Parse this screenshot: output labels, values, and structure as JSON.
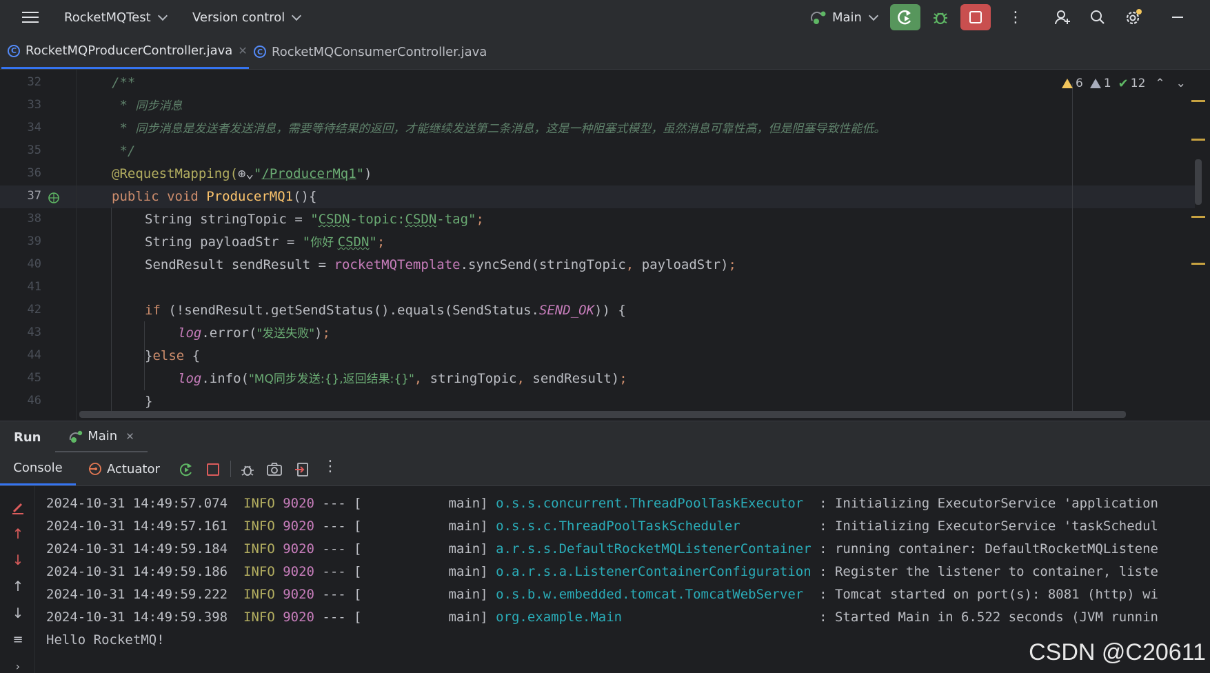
{
  "topbar": {
    "project": "RocketMQTest",
    "vcs": "Version control",
    "run_config": "Main"
  },
  "tabs": [
    {
      "label": "RocketMQProducerController.java",
      "active": true
    },
    {
      "label": "RocketMQConsumerController.java",
      "active": false
    }
  ],
  "inspections": {
    "warnings": "6",
    "weak_warnings": "1",
    "ok": "12"
  },
  "editor": {
    "line_numbers": [
      "32",
      "33",
      "34",
      "35",
      "36",
      "37",
      "38",
      "39",
      "40",
      "41",
      "42",
      "43",
      "44",
      "45",
      "46"
    ],
    "current_line": "37",
    "lines": {
      "l32": "/**",
      "l33_star": " * ",
      "l33_text": "同步消息",
      "l34_star": " * ",
      "l34_text": "同步消息是发送者发送消息，需要等待结果的返回，才能继续发送第二条消息，这是一种阻塞式模型，虽然消息可靠性高，但是阻塞导致性能低。",
      "l35": " */",
      "l36_ann": "@RequestMapping(",
      "l36_globe": "⊕⌄",
      "l36_q1": "\"",
      "l36_path": "/ProducerMq1",
      "l36_q2": "\"",
      "l36_close": ")",
      "l37_kw": "public void ",
      "l37_fn": "ProducerMQ1",
      "l37_rest": "(){",
      "l38_a": "String stringTopic = ",
      "l38_q1": "\"",
      "l38_s1": "CSDN",
      "l38_s2": "-topic:",
      "l38_s3": "CSDN",
      "l38_s4": "-tag",
      "l38_q2": "\"",
      "l38_end": ";",
      "l39_a": "String payloadStr = ",
      "l39_q1": "\"",
      "l39_s1": "你好 ",
      "l39_s2": "CSDN",
      "l39_q2": "\"",
      "l39_end": ";",
      "l40_a": "SendResult sendResult = ",
      "l40_fld": "rocketMQTemplate",
      "l40_b": ".syncSend(stringTopic",
      "l40_c": ", ",
      "l40_d": "payloadStr)",
      "l40_end": ";",
      "l42_kw": "if ",
      "l42_a": "(!sendResult.getSendStatus().equals(SendStatus.",
      "l42_const": "SEND_OK",
      "l42_b": ")) {",
      "l43_log": "log",
      "l43_a": ".error(",
      "l43_str": "\"发送失败\"",
      "l43_b": ")",
      "l43_end": ";",
      "l44_a": "}",
      "l44_kw": "else",
      "l44_b": " {",
      "l45_log": "log",
      "l45_a": ".info(",
      "l45_str": "\"MQ同步发送:{},返回结果:{}\"",
      "l45_c": ", ",
      "l45_b": "stringTopic",
      "l45_d": ", ",
      "l45_e": "sendResult)",
      "l45_end": ";",
      "l46": "}"
    }
  },
  "run_panel": {
    "title": "Run",
    "tab": "Main",
    "console_tab": "Console",
    "actuator_tab": "Actuator"
  },
  "console": {
    "rows": [
      {
        "ts": "2024-10-31 14:49:57.074",
        "level": "INFO",
        "pid": "9020",
        "sep": " --- [           main] ",
        "logger": "o.s.s.concurrent.ThreadPoolTaskExecutor ",
        "msg": " : Initializing ExecutorService 'application"
      },
      {
        "ts": "2024-10-31 14:49:57.161",
        "level": "INFO",
        "pid": "9020",
        "sep": " --- [           main] ",
        "logger": "o.s.s.c.ThreadPoolTaskScheduler         ",
        "msg": " : Initializing ExecutorService 'taskSchedul"
      },
      {
        "ts": "2024-10-31 14:49:59.184",
        "level": "INFO",
        "pid": "9020",
        "sep": " --- [           main] ",
        "logger": "a.r.s.s.DefaultRocketMQListenerContainer",
        "msg": " : running container: DefaultRocketMQListene"
      },
      {
        "ts": "2024-10-31 14:49:59.186",
        "level": "INFO",
        "pid": "9020",
        "sep": " --- [           main] ",
        "logger": "o.a.r.s.a.ListenerContainerConfiguration",
        "msg": " : Register the listener to container, liste"
      },
      {
        "ts": "2024-10-31 14:49:59.222",
        "level": "INFO",
        "pid": "9020",
        "sep": " --- [           main] ",
        "logger": "o.s.b.w.embedded.tomcat.TomcatWebServer ",
        "msg": " : Tomcat started on port(s): 8081 (http) wi"
      },
      {
        "ts": "2024-10-31 14:49:59.398",
        "level": "INFO",
        "pid": "9020",
        "sep": " --- [           main] ",
        "logger": "org.example.Main                        ",
        "msg": " : Started Main in 6.522 seconds (JVM runnin"
      }
    ],
    "hello": "Hello RocketMQ!",
    "watermark": "CSDN @C20611"
  }
}
